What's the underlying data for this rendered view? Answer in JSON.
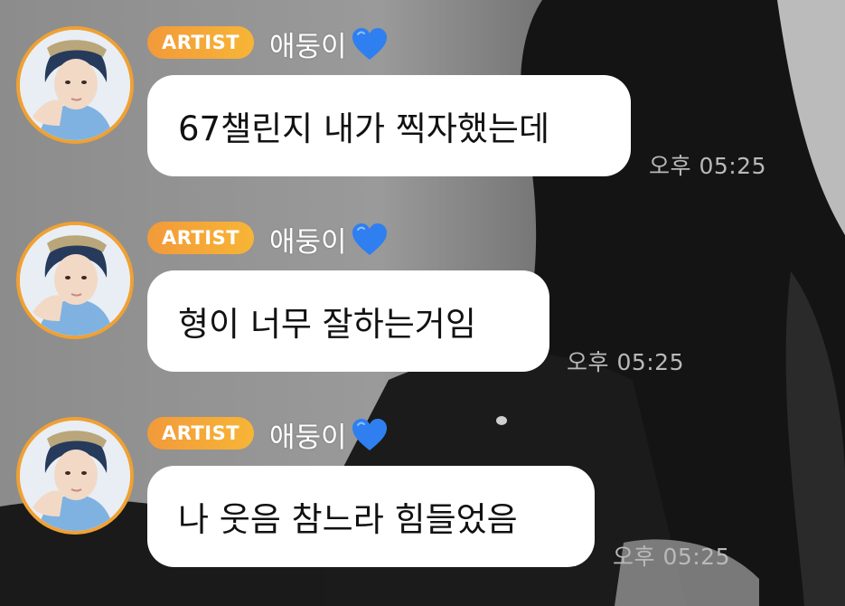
{
  "messages": [
    {
      "badge": "ARTIST",
      "sender": "애둥이",
      "text": "67챌린지 내가 찍자했는데",
      "time": "오후 05:25"
    },
    {
      "badge": "ARTIST",
      "sender": "애둥이",
      "text": "형이 너무 잘하는거임",
      "time": "오후 05:25"
    },
    {
      "badge": "ARTIST",
      "sender": "애둥이",
      "text": "나 웃음 참느라 힘들었음",
      "time": "오후 05:25"
    }
  ],
  "colors": {
    "badge_start": "#f29a3a",
    "badge_end": "#f7b536",
    "avatar_ring": "#f0a133",
    "heart": "#2f7ff0",
    "bubble": "#ffffff",
    "timestamp": "#b9b9b9"
  },
  "icons": {
    "heart": "blue-heart-emoji",
    "avatar": "profile-photo"
  }
}
